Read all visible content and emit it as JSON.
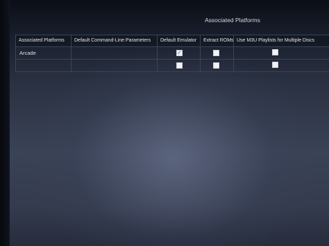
{
  "section": {
    "title": "Associated Platforms"
  },
  "table": {
    "columns": [
      "Associated Platforms",
      "Default Command-Line Parameters",
      "Default Emulator",
      "Extract ROMs",
      "Use M3U Playlists for Multiple Discs"
    ],
    "rows": [
      {
        "platform": "Arcade",
        "command_line_parameters": "",
        "default_emulator": true,
        "extract_roms": false,
        "use_m3u_playlists": false
      },
      {
        "platform": "",
        "command_line_parameters": "",
        "default_emulator": false,
        "extract_roms": false,
        "use_m3u_playlists": false
      }
    ]
  },
  "icons": {
    "checked": "checkmark-icon"
  }
}
